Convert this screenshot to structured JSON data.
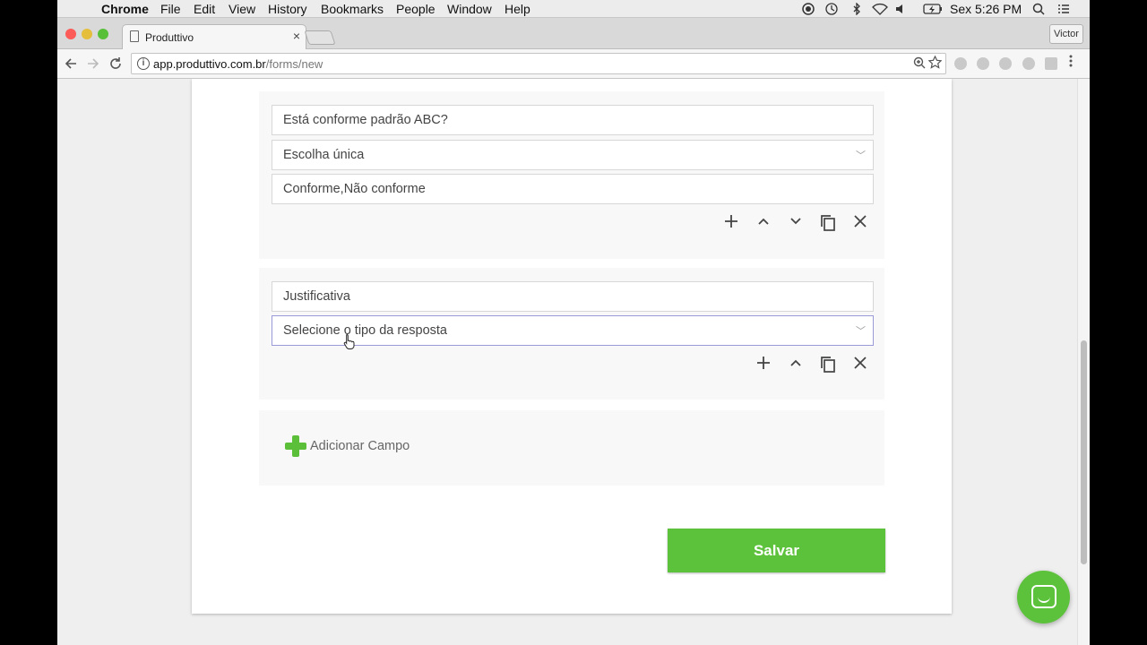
{
  "menubar": {
    "app": "Chrome",
    "items": [
      "File",
      "Edit",
      "View",
      "History",
      "Bookmarks",
      "People",
      "Window",
      "Help"
    ],
    "clock": "Sex 5:26 PM"
  },
  "browser": {
    "tab_title": "Produttivo",
    "tab_close": "×",
    "profile": "Victor",
    "url_host": "app.produttivo.com.br",
    "url_path": "/forms/new"
  },
  "form": {
    "block1": {
      "question": "Está conforme padrão ABC?",
      "type": "Escolha única",
      "options": "Conforme,Não conforme"
    },
    "block2": {
      "question": "Justificativa",
      "type_placeholder": "Selecione o tipo da resposta"
    },
    "add_field_label": "Adicionar Campo",
    "save_label": "Salvar"
  },
  "colors": {
    "accent_green": "#5dc23b"
  }
}
